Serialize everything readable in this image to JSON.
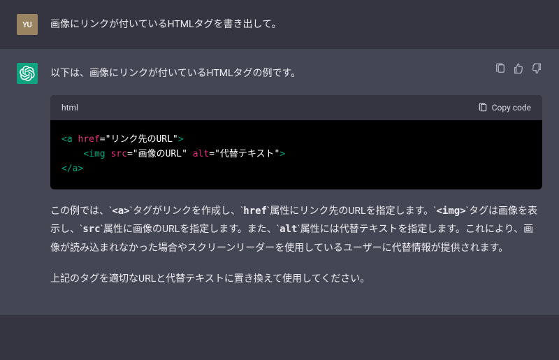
{
  "user": {
    "avatar_text": "YU",
    "message": "画像にリンクが付いているHTMLタグを書き出して。"
  },
  "assistant": {
    "intro": "以下は、画像にリンクが付いているHTMLタグの例です。",
    "code": {
      "language": "html",
      "copy_label": "Copy code",
      "line1_tag_open": "<a",
      "line1_attr": "href",
      "line1_eq": "=",
      "line1_val": "\"リンク先のURL\"",
      "line1_close": ">",
      "line2_indent": "    ",
      "line2_tag_open": "<img",
      "line2_attr1": "src",
      "line2_val1": "\"画像のURL\"",
      "line2_attr2": "alt",
      "line2_val2": "\"代替テキスト\"",
      "line2_close": ">",
      "line3": "</a>"
    },
    "explanation": {
      "p1_prefix": "この例では、`",
      "p1_code1": "<a>",
      "p1_mid1": "`タグがリンクを作成し、`",
      "p1_code2": "href",
      "p1_mid2": "`属性にリンク先のURLを指定します。`",
      "p1_code3": "<img>",
      "p1_mid3": "`タグは画像を表示し、`",
      "p1_code4": "src",
      "p1_mid4": "`属性に画像のURLを指定します。また、`",
      "p1_code5": "alt",
      "p1_suffix": "`属性には代替テキストを指定します。これにより、画像が読み込まれなかった場合やスクリーンリーダーを使用しているユーザーに代替情報が提供されます。",
      "p2": "上記のタグを適切なURLと代替テキストに置き換えて使用してください。"
    }
  }
}
